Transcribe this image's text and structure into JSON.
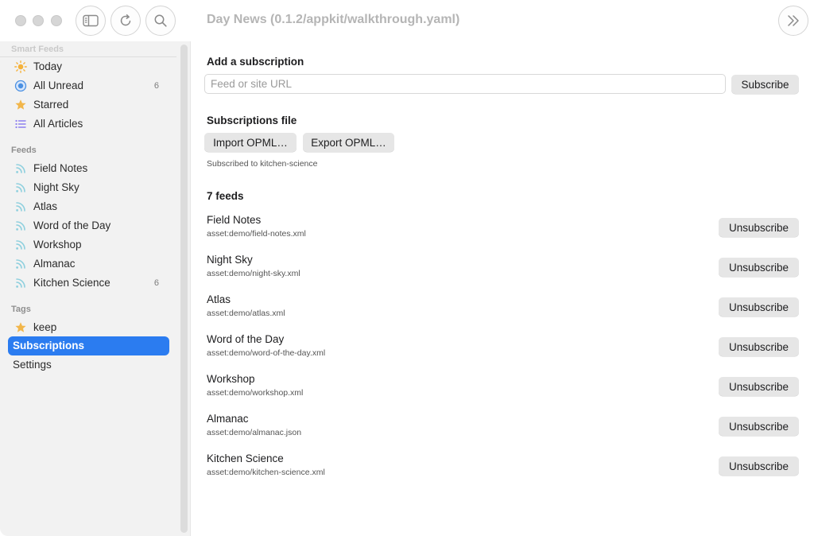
{
  "window": {
    "title": "Day News (0.1.2/appkit/walkthrough.yaml)",
    "accent": "#2b7cf0"
  },
  "toolbar": {
    "buttons": [
      {
        "icon": "sidebar-toggle-icon"
      },
      {
        "icon": "refresh-icon"
      },
      {
        "icon": "search-icon"
      },
      {
        "icon": "chevron-double-right-icon"
      }
    ]
  },
  "sidebar": {
    "smart_feeds_label": "Smart Feeds",
    "smart_feeds": [
      {
        "label": "Today",
        "icon": "sun-icon",
        "count": ""
      },
      {
        "label": "All Unread",
        "icon": "unread-circle-icon",
        "count": "6"
      },
      {
        "label": "Starred",
        "icon": "star-icon",
        "count": ""
      },
      {
        "label": "All Articles",
        "icon": "list-icon",
        "count": ""
      }
    ],
    "feeds_label": "Feeds",
    "feeds": [
      {
        "label": "Field Notes",
        "icon": "rss-icon",
        "count": ""
      },
      {
        "label": "Night Sky",
        "icon": "rss-icon",
        "count": ""
      },
      {
        "label": "Atlas",
        "icon": "rss-icon",
        "count": ""
      },
      {
        "label": "Word of the Day",
        "icon": "rss-icon",
        "count": ""
      },
      {
        "label": "Workshop",
        "icon": "rss-icon",
        "count": ""
      },
      {
        "label": "Almanac",
        "icon": "rss-icon",
        "count": ""
      },
      {
        "label": "Kitchen Science",
        "icon": "rss-icon",
        "count": "6"
      }
    ],
    "tags_label": "Tags",
    "tags": [
      {
        "label": "keep",
        "icon": "star-icon"
      }
    ],
    "subscriptions_label": "Subscriptions",
    "settings_label": "Settings"
  },
  "main": {
    "add_heading": "Add a subscription",
    "url_placeholder": "Feed or site URL",
    "url_value": "",
    "subscribe_label": "Subscribe",
    "file_heading": "Subscriptions file",
    "import_label": "Import OPML…",
    "export_label": "Export OPML…",
    "status_note": "Subscribed to kitchen-science",
    "feeds_heading": "7 feeds",
    "unsubscribe_label": "Unsubscribe",
    "feeds": [
      {
        "name": "Field Notes",
        "url": "asset:demo/field-notes.xml"
      },
      {
        "name": "Night Sky",
        "url": "asset:demo/night-sky.xml"
      },
      {
        "name": "Atlas",
        "url": "asset:demo/atlas.xml"
      },
      {
        "name": "Word of the Day",
        "url": "asset:demo/word-of-the-day.xml"
      },
      {
        "name": "Workshop",
        "url": "asset:demo/workshop.xml"
      },
      {
        "name": "Almanac",
        "url": "asset:demo/almanac.json"
      },
      {
        "name": "Kitchen Science",
        "url": "asset:demo/kitchen-science.xml"
      }
    ]
  }
}
